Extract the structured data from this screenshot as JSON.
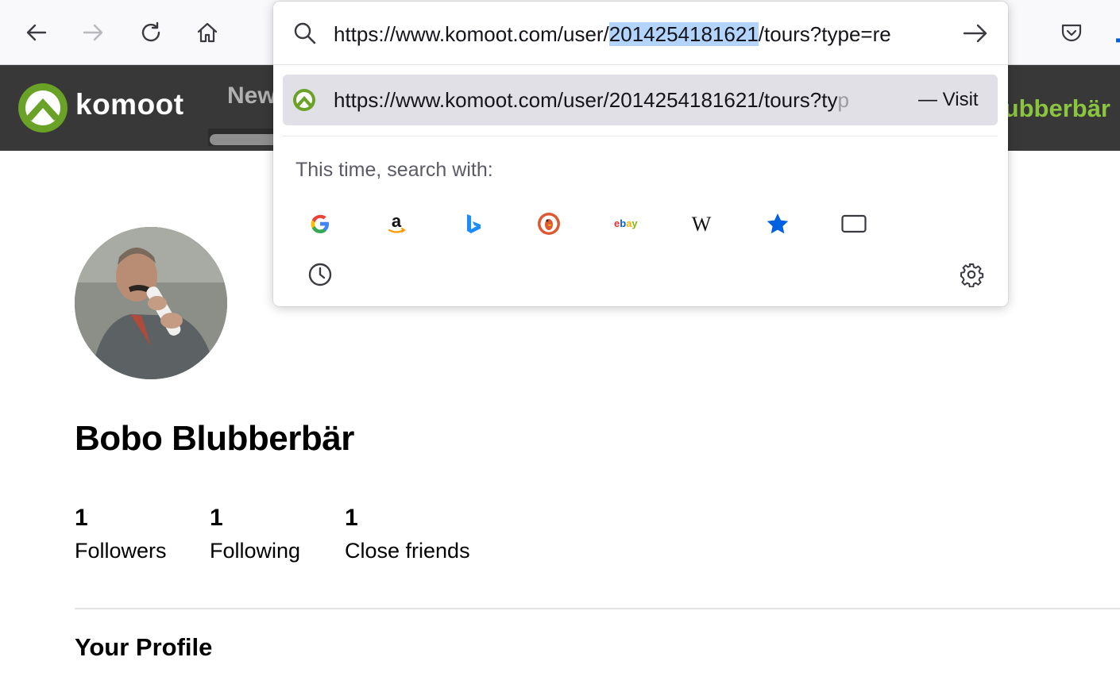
{
  "browser": {
    "toolbar": {
      "back_icon": "arrow-left-icon",
      "forward_icon": "arrow-right-icon",
      "reload_icon": "reload-icon",
      "home_icon": "home-icon",
      "pocket_icon": "pocket-icon"
    },
    "urlbar": {
      "value_before": "https://www.komoot.com/user/",
      "value_selected": "2014254181621",
      "value_after": "/tours?type=re",
      "go_icon": "arrow-right-icon",
      "search_icon": "search-icon"
    },
    "suggestion": {
      "url_visible": "https://www.komoot.com/user/2014254181621/tours?ty",
      "url_faded": "p",
      "separator": "—",
      "action": "Visit",
      "favicon": "komoot-favicon"
    },
    "search_with_label": "This time, search with:",
    "engines": [
      {
        "name": "Google",
        "icon": "google-icon"
      },
      {
        "name": "Amazon",
        "icon": "amazon-icon"
      },
      {
        "name": "Bing",
        "icon": "bing-icon"
      },
      {
        "name": "DuckDuckGo",
        "icon": "duckduckgo-icon"
      },
      {
        "name": "eBay",
        "icon": "ebay-icon"
      },
      {
        "name": "Wikipedia",
        "icon": "wikipedia-icon"
      },
      {
        "name": "Bookmarks",
        "icon": "star-icon"
      },
      {
        "name": "Tabs",
        "icon": "tab-icon"
      },
      {
        "name": "History",
        "icon": "clock-icon"
      }
    ],
    "settings_icon": "gear-icon",
    "ebay_text": "ebay",
    "wiki_text": "W"
  },
  "site": {
    "brand": "komoot",
    "nav_visible": "New",
    "header_user": "lubberbär",
    "colors": {
      "brand_green": "#6aa127",
      "header_bg": "#383838",
      "user_green": "#8bc53f"
    }
  },
  "profile": {
    "name": "Bobo Blubberbär",
    "stats": [
      {
        "value": "1",
        "label": "Followers"
      },
      {
        "value": "1",
        "label": "Following"
      },
      {
        "value": "1",
        "label": "Close friends"
      }
    ],
    "section_title": "Your Profile"
  }
}
